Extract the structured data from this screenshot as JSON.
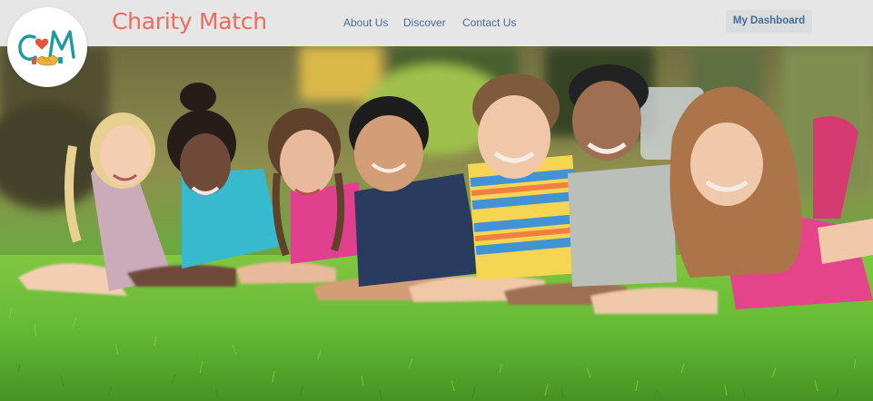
{
  "header": {
    "logo_text": "CM",
    "brand": "Charity Match",
    "nav": [
      {
        "label": "About Us"
      },
      {
        "label": "Discover"
      },
      {
        "label": "Contact Us"
      }
    ],
    "dashboard_button": "My Dashboard"
  },
  "hero": {
    "image_alt": "Group of smiling children lying on the grass in a park",
    "children": [
      {
        "name": "child-blonde-ponytail",
        "shirt": "#c9a7b8",
        "hair": "#e8d08c",
        "skin": "#f4cdb0"
      },
      {
        "name": "child-curly-hair-teal-shirt",
        "shirt": "#2fb8cc",
        "hair": "#1e1410",
        "skin": "#6b4330"
      },
      {
        "name": "child-braids-pink-top",
        "shirt": "#e0398a",
        "hair": "#5a3a24",
        "skin": "#e8b796"
      },
      {
        "name": "child-navy-tshirt",
        "shirt": "#22335a",
        "hair": "#151414",
        "skin": "#d29a72"
      },
      {
        "name": "child-striped-shirt",
        "shirt": "#f5d44a",
        "hair": "#7a5536",
        "skin": "#f0c5a4"
      },
      {
        "name": "child-grey-tshirt",
        "shirt": "#b8bdb8",
        "hair": "#1a1a1a",
        "skin": "#9c6a4b"
      },
      {
        "name": "child-long-hair-pink-shirt",
        "shirt": "#e43d86",
        "hair": "#a86f42",
        "skin": "#f0c7a8"
      }
    ]
  },
  "colors": {
    "header_bg": "#e6e6e6",
    "brand": "#f26a5b",
    "nav_text": "#4a6b93",
    "button_bg": "#dadde0",
    "grass": "#5fb82c",
    "logo_teal": "#1f9a9e",
    "logo_red": "#e5533e"
  }
}
